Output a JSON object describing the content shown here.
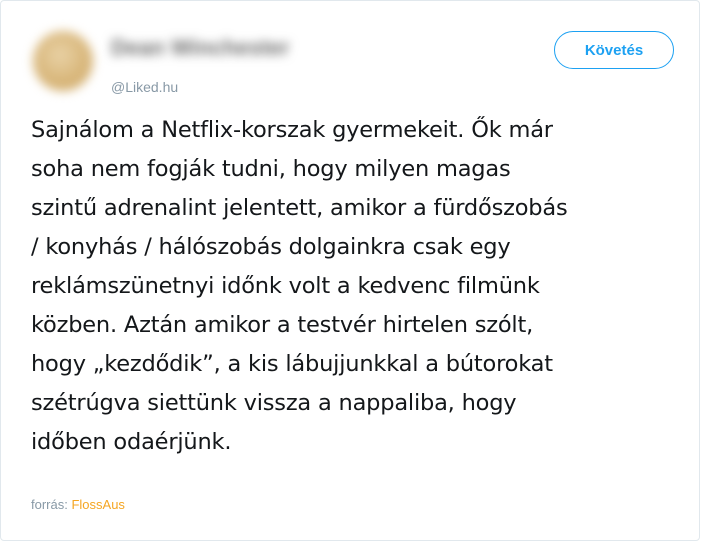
{
  "tweet": {
    "display_name": "Dean Winchester",
    "handle": "@Liked.hu",
    "follow_label": "Követés",
    "lines": [
      "Sajnálom a Netflix-korszak gyermekeit. Ők már",
      "soha nem fogják tudni, hogy milyen magas",
      "szintű adrenalint jelentett, amikor a fürdőszobás",
      "/ konyhás / hálószobás dolgainkra csak egy",
      "reklámszünetnyi időnk volt a kedvenc filmünk",
      "közben. Aztán amikor a testvér hirtelen szólt,",
      "hogy „kezdődik”, a kis lábujjunkkal a bútorokat",
      "szétrúgva siettünk vissza a nappaliba, hogy",
      "időben odaérjünk."
    ]
  },
  "source": {
    "label": "forrás:",
    "link_text": "FlossAus"
  },
  "colors": {
    "accent": "#1da1f2",
    "source_link": "#f5a623",
    "muted": "#8899a6",
    "text": "#14171a",
    "border": "#e1e8ed"
  }
}
